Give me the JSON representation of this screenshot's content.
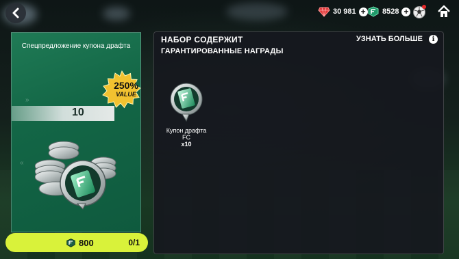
{
  "topbar": {
    "currency_points": "30 981",
    "currency_coins": "8528"
  },
  "offer": {
    "title": "Спецпредложение купона драфта",
    "quantity": "10",
    "badge_percent": "250%",
    "badge_value": "VALUE",
    "colors": {
      "card": "#136646",
      "badge": "#f2c230"
    }
  },
  "buy": {
    "price": "800",
    "count": "0/1",
    "accent": "#d9f23a"
  },
  "pack": {
    "title": "НАБОР СОДЕРЖИТ",
    "learn_more": "УЗНАТЬ БОЛЬШЕ",
    "section": "ГАРАНТИРОВАННЫЕ НАГРАДЫ",
    "rewards": [
      {
        "name": "Купон драфта FC",
        "qty": "x10"
      }
    ]
  }
}
